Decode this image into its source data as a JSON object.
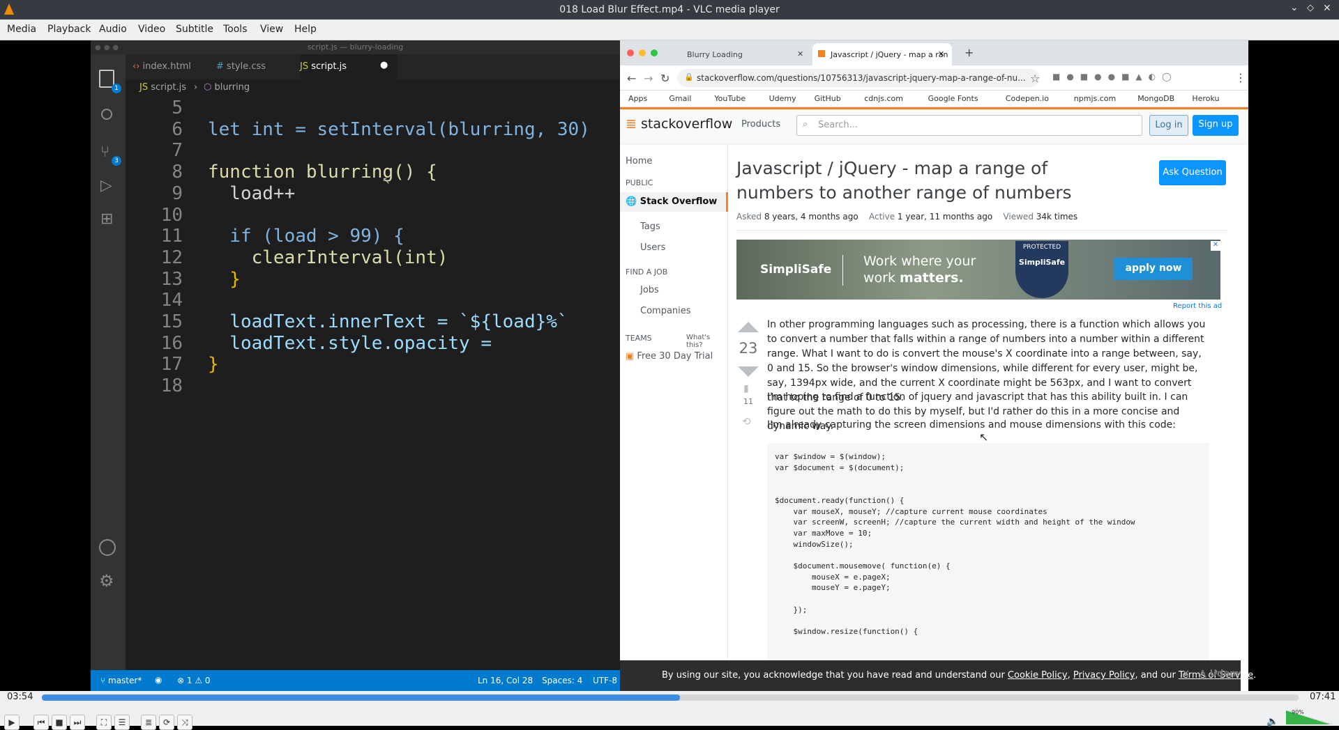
{
  "window": {
    "title": "018 Load Blur Effect.mp4 - VLC media player"
  },
  "menu": [
    "Media",
    "Playback",
    "Audio",
    "Video",
    "Subtitle",
    "Tools",
    "View",
    "Help"
  ],
  "vscode": {
    "window_title": "script.js — blurry-loading",
    "tabs": [
      "index.html",
      "style.css",
      "script.js"
    ],
    "breadcrumb": [
      "script.js",
      "blurring"
    ],
    "explorer_badge": "1",
    "scm_badge": "3",
    "lines": [
      {
        "n": "5",
        "code": ""
      },
      {
        "n": "6",
        "code": "let int = setInterval(blurring, 30)"
      },
      {
        "n": "7",
        "code": ""
      },
      {
        "n": "8",
        "code": "function blurring() {"
      },
      {
        "n": "9",
        "code": "  load++"
      },
      {
        "n": "10",
        "code": ""
      },
      {
        "n": "11",
        "code": "  if (load > 99) {"
      },
      {
        "n": "12",
        "code": "    clearInterval(int)"
      },
      {
        "n": "13",
        "code": "  }"
      },
      {
        "n": "14",
        "code": ""
      },
      {
        "n": "15",
        "code": "  loadText.innerText = `${load}%`"
      },
      {
        "n": "16",
        "code": "  loadText.style.opacity ="
      },
      {
        "n": "17",
        "code": "}"
      },
      {
        "n": "18",
        "code": ""
      }
    ],
    "status": {
      "branch": "master*",
      "problems": "⊗ 1 ⚠ 0",
      "position": "Ln 16, Col 28",
      "spaces": "Spaces: 4",
      "encoding": "UTF-8"
    }
  },
  "browser": {
    "tabs": [
      "Blurry Loading",
      "Javascript / jQuery - map a ran"
    ],
    "url": "stackoverflow.com/questions/10756313/javascript-jquery-map-a-range-of-nu...",
    "bookmarks": [
      "Apps",
      "Gmail",
      "YouTube",
      "Udemy",
      "GitHub",
      "cdnjs.com",
      "Google Fonts",
      "Codepen.io",
      "npmjs.com",
      "MongoDB",
      "Heroku"
    ],
    "so": {
      "logo": "stackoverflow",
      "products": "Products",
      "search_placeholder": "Search...",
      "login": "Log in",
      "signup": "Sign up",
      "nav": {
        "home": "Home",
        "public": "PUBLIC",
        "stack": "Stack Overflow",
        "tags": "Tags",
        "users": "Users",
        "find_job": "FIND A JOB",
        "jobs": "Jobs",
        "companies": "Companies",
        "teams": "TEAMS",
        "whats_this": "What's this?",
        "trial": "Free 30 Day Trial"
      },
      "question_title": "Javascript / jQuery - map a range of numbers to another range of numbers",
      "ask": "Ask Question",
      "meta": {
        "asked_label": "Asked",
        "asked": "8 years, 4 months ago",
        "active_label": "Active",
        "active": "1 year, 11 months ago",
        "viewed_label": "Viewed",
        "viewed": "34k times"
      },
      "ad": {
        "brand": "SimpliSafe",
        "line1": "Work where your",
        "line2a": "work ",
        "line2b": "matters.",
        "badge_top": "PROTECTED",
        "badge": "SimpliSafe",
        "cta": "apply now",
        "report": "Report this ad"
      },
      "votes": "23",
      "bookmarks_count": "11",
      "p1": "In other programming languages such as processing, there is a function which allows you to convert a number that falls within a range of numbers into a number within a different range. What I want to do is convert the mouse's X coordinate into a range between, say, 0 and 15. So the browser's window dimensions, while different for every user, might be, say, 1394px wide, and the current X coordinate might be 563px, and I want to convert that to the range of 0 to 15.",
      "p2": "I'm hoping to find a function of jquery and javascript that has this ability built in. I can figure out the math to do this by myself, but I'd rather do this in a more concise and dynamic way.",
      "p3": "I'm already capturing the screen dimensions and mouse dimensions with this code:",
      "code": "var $window = $(window);\nvar $document = $(document);\n\n\n$document.ready(function() {\n    var mouseX, mouseY; //capture current mouse coordinates\n    var screenW, screenH; //capture the current width and height of the window\n    var maxMove = 10;\n    windowSize();\n\n    $document.mousemove( function(e) {\n        mouseX = e.pageX;\n        mouseY = e.pageY;\n\n    });\n\n    $window.resize(function() {",
      "cookie": {
        "pre": "By using our site, you acknowledge that you have read and understand our ",
        "cookie_policy": "Cookie Policy",
        "comma": ", ",
        "privacy_policy": "Privacy Policy",
        "and": ", and our ",
        "terms": "Terms of Service",
        "end": ".",
        "udemy": "Udemy"
      }
    }
  },
  "player": {
    "elapsed": "03:54",
    "total": "07:41",
    "progress": 0.508,
    "volume_label": "90%",
    "volume": 0.9
  }
}
